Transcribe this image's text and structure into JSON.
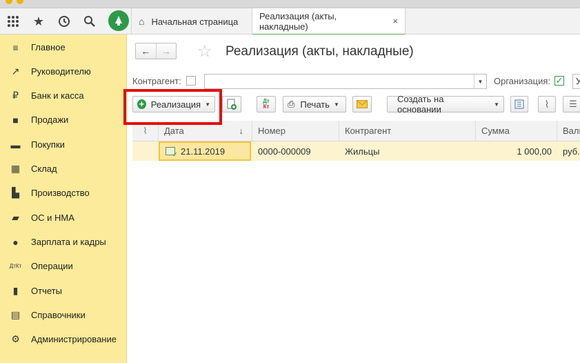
{
  "topbar": {
    "icons": [
      "apps-grid-icon",
      "star-icon",
      "history-icon",
      "search-icon",
      "bell-icon"
    ],
    "tabs": [
      {
        "label": "Начальная страница"
      },
      {
        "label": "Реализация (акты, накладные)"
      }
    ],
    "close_symbol": "×"
  },
  "sidebar": {
    "items": [
      {
        "label": "Главное",
        "icon": "menu-icon",
        "glyph": "≡"
      },
      {
        "label": "Руководителю",
        "icon": "chart-line-icon",
        "glyph": "↗"
      },
      {
        "label": "Банк и касса",
        "icon": "ruble-coin-icon",
        "glyph": "₽"
      },
      {
        "label": "Продажи",
        "icon": "shopping-bag-icon",
        "glyph": "■"
      },
      {
        "label": "Покупки",
        "icon": "cart-icon",
        "glyph": "▬"
      },
      {
        "label": "Склад",
        "icon": "warehouse-icon",
        "glyph": "▦"
      },
      {
        "label": "Производство",
        "icon": "factory-icon",
        "glyph": "▙"
      },
      {
        "label": "ОС и НМА",
        "icon": "truck-icon",
        "glyph": "▰"
      },
      {
        "label": "Зарплата и кадры",
        "icon": "person-icon",
        "glyph": "●"
      },
      {
        "label": "Операции",
        "icon": "dt-kt-icon",
        "glyph": "ДтКт"
      },
      {
        "label": "Отчеты",
        "icon": "bar-chart-icon",
        "glyph": "▮"
      },
      {
        "label": "Справочники",
        "icon": "books-icon",
        "glyph": "▤"
      },
      {
        "label": "Администрирование",
        "icon": "gear-icon",
        "glyph": "⚙"
      }
    ]
  },
  "page": {
    "title": "Реализация (акты, накладные)"
  },
  "filters": {
    "counterparty_label": "Контрагент:",
    "counterparty_value": "",
    "organization_label": "Организация:",
    "organization_value": "У"
  },
  "commands": {
    "create_label": "Реализация",
    "print_label": "Печать",
    "create_based_label": "Создать на основании",
    "dt": "Дт",
    "kt": "Кт"
  },
  "table": {
    "columns": [
      "Дата",
      "Номер",
      "Контрагент",
      "Сумма",
      "Валю"
    ],
    "sort_indicator": "↓",
    "rows": [
      {
        "date": "21.11.2019",
        "number": "0000-000009",
        "counterparty": "Жильцы",
        "sum": "1 000,00",
        "currency": "руб."
      }
    ]
  },
  "colors": {
    "sidebar": "#fbeb9a",
    "accent_green": "#2e9a48",
    "highlight_red": "#e30d0d",
    "selected_row": "#fcf4cf"
  }
}
